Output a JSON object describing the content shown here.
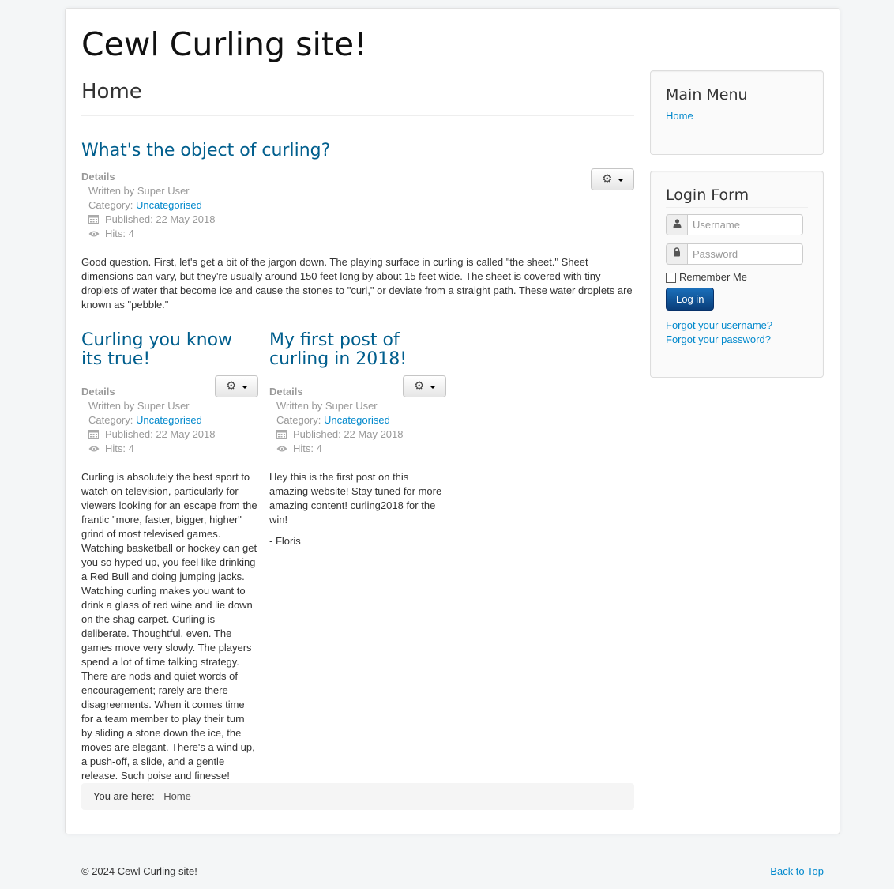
{
  "site": {
    "title": "Cewl Curling site!"
  },
  "page": {
    "title": "Home"
  },
  "featured": {
    "title": "What's the object of curling?",
    "details_label": "Details",
    "written_by": "Written by Super User",
    "category_label": "Category: ",
    "category": "Uncategorised",
    "published": "Published: 22 May 2018",
    "hits": "Hits: 4",
    "body": "Good question. First, let's get a bit of the jargon down. The playing surface in curling is called \"the sheet.\" Sheet dimensions can vary, but they're usually around 150 feet long by about 15 feet wide. The sheet is covered with tiny droplets of water that become ice and cause the stones to \"curl,\" or deviate from a straight path. These water droplets are known as \"pebble.\""
  },
  "articles": [
    {
      "title": "Curling you know its true!",
      "details_label": "Details",
      "written_by": "Written by Super User",
      "category_label": "Category: ",
      "category": "Uncategorised",
      "published": "Published: 22 May 2018",
      "hits": "Hits: 4",
      "body": "Curling is absolutely the best sport to watch on television, particularly for viewers looking for an escape from the frantic \"more, faster, bigger, higher\" grind of most televised games. Watching basketball or hockey can get you so hyped up, you feel like drinking a Red Bull and doing jumping jacks. Watching curling makes you want to drink a glass of red wine and lie down on the shag carpet. Curling is deliberate. Thoughtful, even. The games move very slowly. The players spend a lot of time talking strategy. There are nods and quiet words of encouragement; rarely are there disagreements. When it comes time for a team member to play their turn by sliding a stone down the ice, the moves are elegant. There's a wind up, a push-off, a slide, and a gentle release. Such poise and finesse!"
    },
    {
      "title": "My first post of curling in 2018!",
      "details_label": "Details",
      "written_by": "Written by Super User",
      "category_label": "Category: ",
      "category": "Uncategorised",
      "published": "Published: 22 May 2018",
      "hits": "Hits: 4",
      "body": "Hey this is the first post on this amazing website! Stay tuned for more amazing content! curling2018 for the win!",
      "signature": "- Floris"
    }
  ],
  "breadcrumb": {
    "label": "You are here:",
    "home": "Home"
  },
  "main_menu": {
    "title": "Main Menu",
    "items": [
      "Home"
    ]
  },
  "login": {
    "title": "Login Form",
    "username_placeholder": "Username",
    "password_placeholder": "Password",
    "remember_label": "Remember Me",
    "button": "Log in",
    "forgot_username": "Forgot your username?",
    "forgot_password": "Forgot your password?"
  },
  "footer": {
    "copyright": "© 2024 Cewl Curling site!",
    "back_to_top": "Back to Top"
  },
  "icons": [
    "gear-icon",
    "calendar-icon",
    "eye-icon",
    "user-icon",
    "lock-icon",
    "caret-down-icon"
  ],
  "colors": {
    "link": "#0088cc",
    "heading_link": "#005e8d",
    "button_primary": "#0a4a8e"
  }
}
